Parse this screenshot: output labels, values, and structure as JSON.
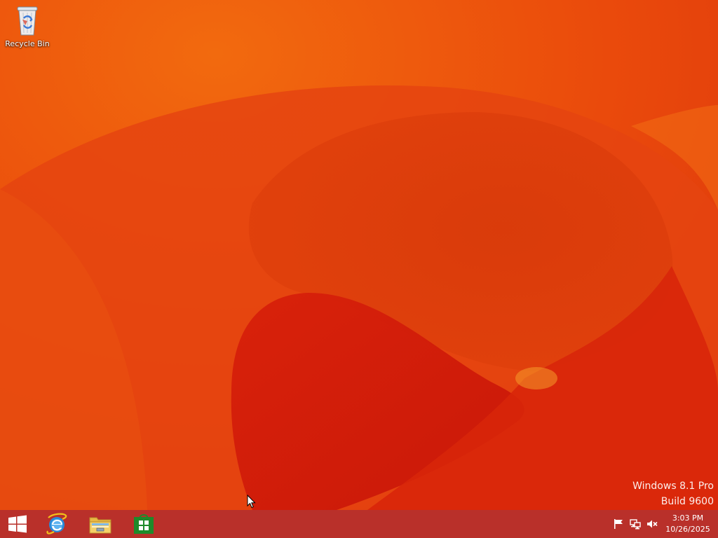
{
  "desktop": {
    "icons": [
      {
        "label": "Recycle Bin",
        "icon": "recycle-bin-icon"
      }
    ],
    "watermark": {
      "line1": "Windows 8.1 Pro",
      "line2": "Build 9600"
    }
  },
  "taskbar": {
    "start_icon": "windows-logo-icon",
    "pinned": [
      {
        "icon": "internet-explorer-icon"
      },
      {
        "icon": "file-explorer-icon"
      },
      {
        "icon": "store-icon"
      }
    ],
    "tray": {
      "icons": [
        "flag-icon",
        "network-icon",
        "volume-muted-icon"
      ],
      "time": "3:03 PM",
      "date": "10/26/2025"
    }
  },
  "colors": {
    "wallpaper_base": "#e84a10",
    "wallpaper_dark": "#c81e08",
    "wallpaper_light": "#f07a10",
    "taskbar": "#b9302a",
    "store_green": "#1e8a2a",
    "ie_blue": "#2a8ad8"
  }
}
